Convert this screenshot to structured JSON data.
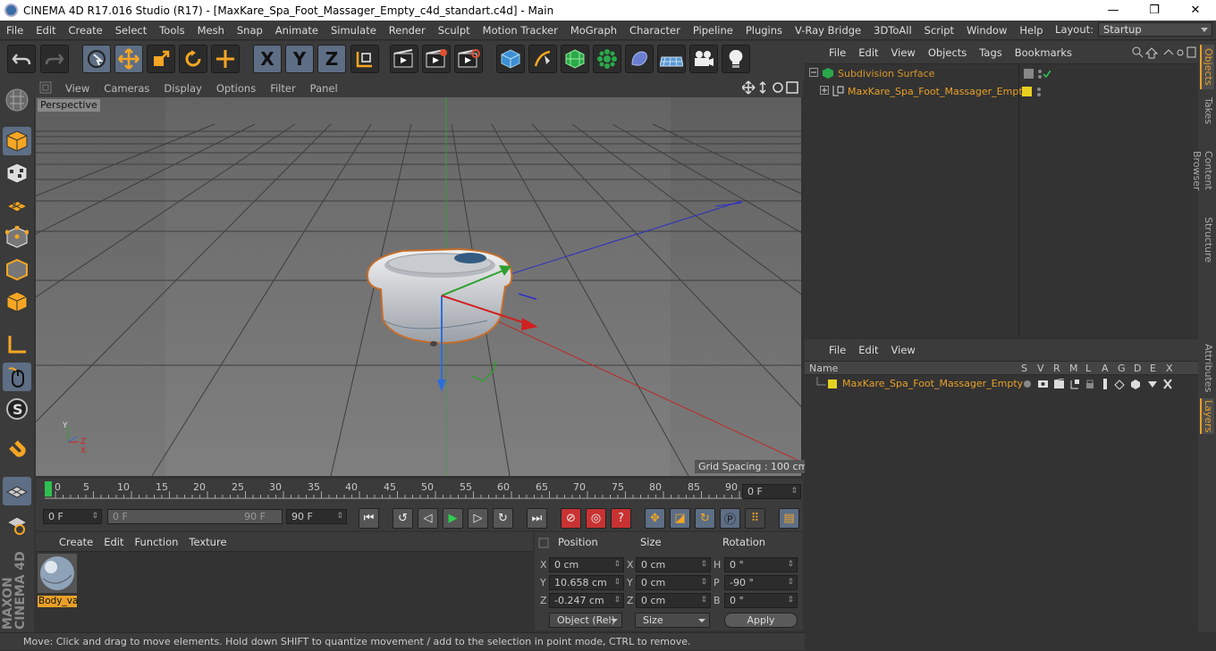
{
  "window": {
    "title": "CINEMA 4D R17.016 Studio (R17) - [MaxKare_Spa_Foot_Massager_Empty_c4d_standart.c4d] - Main",
    "minimize": "—",
    "maximize": "❐",
    "close": "✕"
  },
  "menu": [
    "File",
    "Edit",
    "Create",
    "Select",
    "Tools",
    "Mesh",
    "Snap",
    "Animate",
    "Simulate",
    "Render",
    "Sculpt",
    "Motion Tracker",
    "MoGraph",
    "Character",
    "Pipeline",
    "Plugins",
    "V-Ray Bridge",
    "3DToAll",
    "Script",
    "Window",
    "Help"
  ],
  "layout": {
    "label": "Layout:",
    "value": "Startup"
  },
  "toolbar": {
    "x": "X",
    "y": "Y",
    "z": "Z"
  },
  "viewport": {
    "menu": [
      "View",
      "Cameras",
      "Display",
      "Options",
      "Filter",
      "Panel"
    ],
    "label": "Perspective",
    "grid_spacing": "Grid Spacing : 100 cm"
  },
  "timeline": {
    "ticks": [
      "0",
      "5",
      "10",
      "15",
      "20",
      "25",
      "30",
      "35",
      "40",
      "45",
      "50",
      "55",
      "60",
      "65",
      "70",
      "75",
      "80",
      "85",
      "90"
    ],
    "current": "0 F"
  },
  "transport": {
    "start": "0 F",
    "range_start": "0 F",
    "range_end": "90 F",
    "end": "90 F"
  },
  "material": {
    "menu": [
      "Create",
      "Edit",
      "Function",
      "Texture"
    ],
    "item": "Body_va"
  },
  "coordinates": {
    "headers": {
      "position": "Position",
      "size": "Size",
      "rotation": "Rotation"
    },
    "pos": {
      "x": "0 cm",
      "y": "10.658 cm",
      "z": "-0.247 cm"
    },
    "size": {
      "x": "0 cm",
      "y": "0 cm",
      "z": "0 cm"
    },
    "rot": {
      "h": "0 °",
      "p": "-90 °",
      "b": "0 °"
    },
    "axis_labels": {
      "x": "X",
      "y": "Y",
      "z": "Z",
      "h": "H",
      "p": "P",
      "b": "B"
    },
    "mode": "Object (Rel)",
    "size_mode": "Size",
    "apply": "Apply"
  },
  "objects": {
    "menu": [
      "File",
      "Edit",
      "View",
      "Objects",
      "Tags",
      "Bookmarks"
    ],
    "items": [
      "Subdivision Surface",
      "MaxKare_Spa_Foot_Massager_Empty"
    ]
  },
  "layers": {
    "menu": [
      "File",
      "Edit",
      "View"
    ],
    "columns": [
      "Name",
      "S",
      "V",
      "R",
      "M",
      "L",
      "A",
      "G",
      "D",
      "E",
      "X"
    ],
    "item": "MaxKare_Spa_Foot_Massager_Empty"
  },
  "side_tabs": [
    "Objects",
    "Takes",
    "Content Browser",
    "Structure",
    "Attributes",
    "Layers"
  ],
  "status": "Move: Click and drag to move elements. Hold down SHIFT to quantize movement / add to the selection in point mode, CTRL to remove.",
  "brand": "MAXON CINEMA 4D"
}
